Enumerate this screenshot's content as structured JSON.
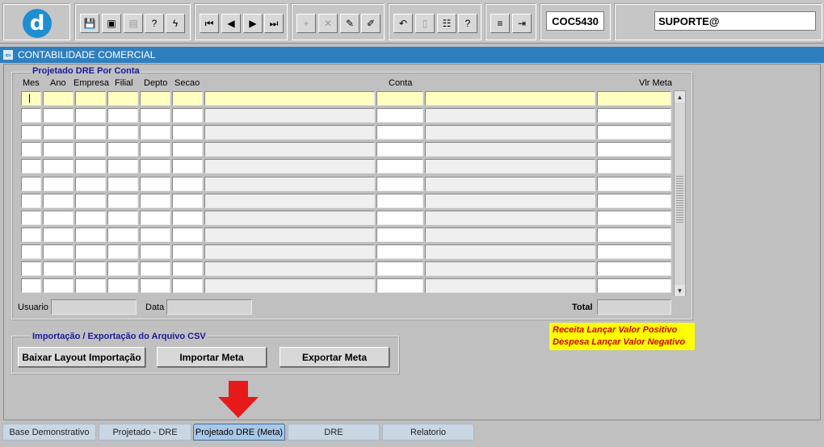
{
  "toolbar": {
    "logo_letter": "d",
    "module_code": "COC5430",
    "user": "SUPORTE@"
  },
  "window": {
    "title": "CONTABILIDADE COMERCIAL",
    "icon_glyph": "⇦"
  },
  "grid": {
    "title": "Projetado DRE Por Conta",
    "columns": [
      "Mes",
      "Ano",
      "Empresa",
      "Filial",
      "Depto",
      "Secao",
      "Conta",
      "Vlr Meta"
    ],
    "rows": 12,
    "cursor_value": "|"
  },
  "footer_fields": {
    "usuario_label": "Usuario",
    "data_label": "Data",
    "total_label": "Total"
  },
  "csv": {
    "title": "Importação / Exportação do Arquivo CSV",
    "buttons": [
      "Baixar Layout Importação",
      "Importar Meta",
      "Exportar Meta"
    ]
  },
  "note": {
    "line1": "Receita Lançar Valor Positivo",
    "line2": "Despesa Lançar Valor Negativo",
    "bg_color": "#ffff00",
    "text_color": "#d00000"
  },
  "tabs": [
    {
      "label": "Base Demonstrativo",
      "active": false
    },
    {
      "label": "Projetado - DRE",
      "active": false
    },
    {
      "label": "Projetado DRE (Meta)",
      "active": true
    },
    {
      "label": "DRE",
      "active": false
    },
    {
      "label": "Relatorio",
      "active": false
    }
  ],
  "colors": {
    "title_bar": "#2f7fbf",
    "arrow": "#e8191b",
    "current_row": "#ffffc0"
  }
}
